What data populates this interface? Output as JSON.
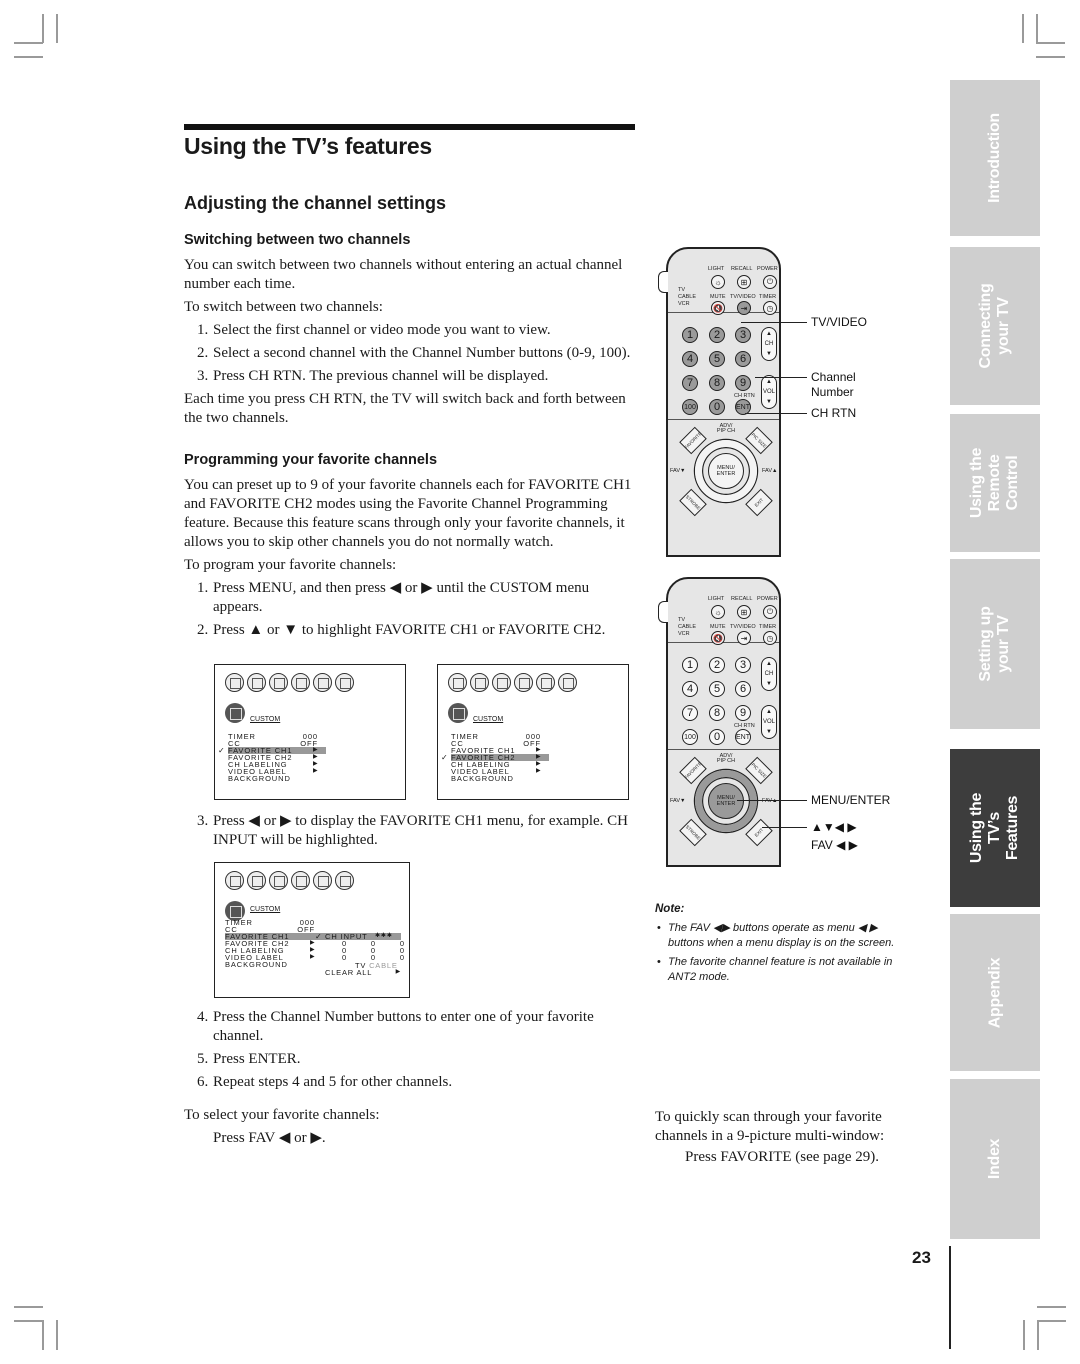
{
  "header": {
    "section_title": "Using the TV’s features",
    "page_title": "Adjusting the channel settings"
  },
  "switching": {
    "heading": "Switching between two channels",
    "intro": "You can switch between two channels without entering an actual channel number each time.",
    "lead": "To switch between two channels:",
    "steps": [
      {
        "num": "1.",
        "text": "Select the first channel or video mode you want to view."
      },
      {
        "num": "2.",
        "text": "Select a second channel with the Channel Number buttons (0-9, 100)."
      },
      {
        "num": "3.",
        "text": "Press CH RTN. The previous channel will be displayed."
      }
    ],
    "outro": "Each time you press CH RTN, the TV will switch back and forth between the two channels."
  },
  "programming": {
    "heading": "Programming your favorite channels",
    "intro": "You can preset up to 9 of your favorite channels each for FAVORITE CH1 and FAVORITE CH2 modes using the Favorite Channel Programming feature. Because this feature scans through only your favorite channels, it allows you to skip other channels you do not normally watch.",
    "lead": "To program your favorite channels:",
    "steps_a": [
      {
        "num": "1.",
        "text": "Press MENU, and then press ◀ or ▶ until the CUSTOM menu appears."
      },
      {
        "num": "2.",
        "text": "Press ▲ or ▼ to highlight FAVORITE CH1 or FAVORITE CH2."
      }
    ],
    "steps_b": [
      {
        "num": "3.",
        "text": "Press ◀ or ▶ to display the FAVORITE CH1 menu, for example. CH INPUT will be highlighted."
      }
    ],
    "steps_c": [
      {
        "num": "4.",
        "text": "Press the Channel Number buttons to enter one of your favorite channel."
      },
      {
        "num": "5.",
        "text": "Press ENTER."
      },
      {
        "num": "6.",
        "text": "Repeat steps 4 and 5 for other channels."
      }
    ],
    "select_lead": "To select your favorite channels:",
    "select_action": "Press FAV ◀ or ▶."
  },
  "osd": {
    "menu_title": "CUSTOM",
    "rows": [
      {
        "label": "TIMER",
        "value": "000",
        "arrow": ""
      },
      {
        "label": "CC",
        "value": "OFF",
        "arrow": ""
      },
      {
        "label": "FAVORITE CH1",
        "value": "",
        "arrow": "▶"
      },
      {
        "label": "FAVORITE CH2",
        "value": "",
        "arrow": "▶"
      },
      {
        "label": "CH LABELING",
        "value": "",
        "arrow": "▶"
      },
      {
        "label": "VIDEO LABEL",
        "value": "",
        "arrow": "▶"
      },
      {
        "label": "BACKGROUND",
        "value": "",
        "arrow": ""
      }
    ],
    "menu1_highlight": "FAVORITE CH1",
    "menu2_highlight": "FAVORITE CH2",
    "submenu": {
      "title": "CH INPUT",
      "title_icon": "✱✱✱",
      "grid": [
        [
          "0",
          "0",
          "0"
        ],
        [
          "0",
          "0",
          "0"
        ],
        [
          "0",
          "0",
          "0"
        ]
      ],
      "source_tv": "TV",
      "source_cable": "CABLE",
      "clear_all": "CLEAR ALL"
    }
  },
  "remote": {
    "top_labels": [
      "LIGHT",
      "RECALL",
      "POWER",
      "MUTE",
      "TV/VIDEO",
      "TIMER"
    ],
    "switch_labels": [
      "TV",
      "CABLE",
      "VCR"
    ],
    "numbers": [
      "1",
      "2",
      "3",
      "4",
      "5",
      "6",
      "7",
      "8",
      "9",
      "100",
      "0",
      "ENT"
    ],
    "ch_rtn_label": "CH RTN",
    "ch_label": "CH",
    "vol_label": "VOL",
    "adv_pip_label": "ADV/ PIP CH",
    "favorite_label": "FAVORITE",
    "pic_size_label": "PIC SIZE",
    "strobe_label": "STROBE",
    "exit_label": "EXIT",
    "fav_down_label": "FAV▼",
    "fav_up_label": "FAV▲",
    "menu_enter_label": "MENU/ ENTER"
  },
  "callouts": {
    "tv_video": "TV/VIDEO",
    "channel_number": "Channel Number",
    "ch_rtn": "CH RTN",
    "menu_enter": "MENU/ENTER",
    "arrows": "▲▼◀ ▶",
    "fav_arrows": "FAV ◀ ▶"
  },
  "note": {
    "heading": "Note:",
    "bullets": [
      "The FAV ◀▶ buttons operate as menu ◀ ▶ buttons when a menu display is on the screen.",
      "The favorite channel feature is not available in ANT2 mode."
    ]
  },
  "scan": {
    "text": "To quickly scan through your favorite channels in a 9-picture multi-window:",
    "action": "Press FAVORITE (see page 29)."
  },
  "side_tabs": [
    {
      "label": "Introduction",
      "active": false
    },
    {
      "label": "Connecting your TV",
      "active": false
    },
    {
      "label": "Using the Remote Control",
      "active": false
    },
    {
      "label": "Setting up your TV",
      "active": false
    },
    {
      "label": "Using the TV’s Features",
      "active": true
    },
    {
      "label": "Appendix",
      "active": false
    },
    {
      "label": "Index",
      "active": false
    }
  ],
  "page_number": "23"
}
